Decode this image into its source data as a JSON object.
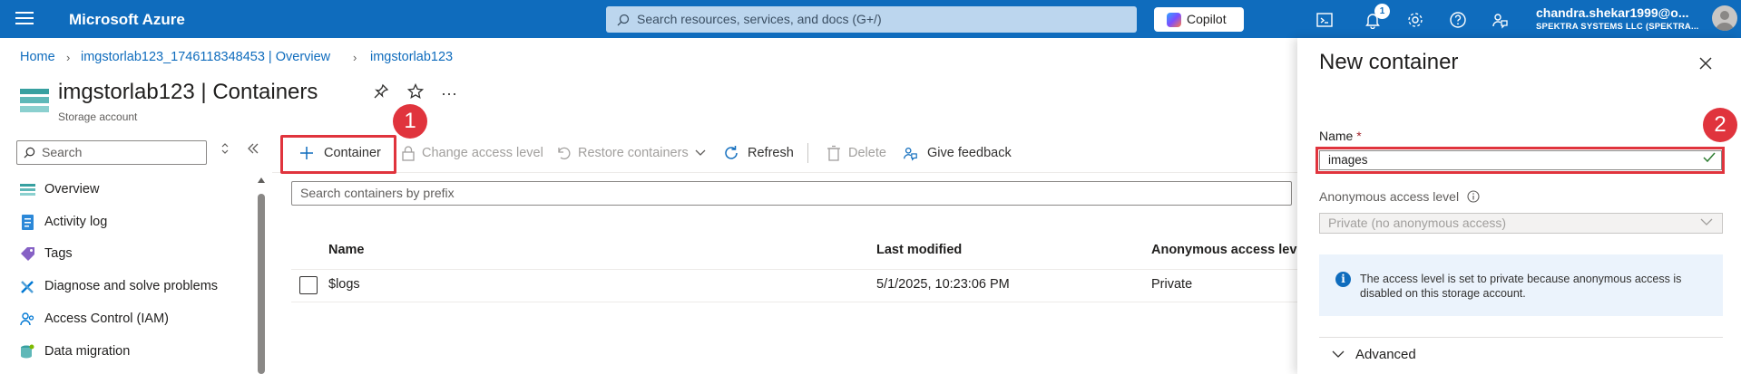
{
  "topbar": {
    "brand": "Microsoft Azure",
    "search_placeholder": "Search resources, services, and docs (G+/)",
    "copilot_label": "Copilot",
    "notification_count": "1",
    "account_user": "chandra.shekar1999@o...",
    "account_org": "SPEKTRA SYSTEMS LLC (SPEKTRA...",
    "icons": [
      "cloud-shell-icon",
      "notifications-icon",
      "settings-icon",
      "help-icon",
      "feedback-icon"
    ]
  },
  "breadcrumb": {
    "items": [
      "Home",
      "imgstorlab123_1746118348453 | Overview",
      "imgstorlab123"
    ]
  },
  "resource": {
    "title": "imgstorlab123 | Containers",
    "subtitle": "Storage account",
    "more": "···"
  },
  "sidebar": {
    "search_placeholder": "Search",
    "items": [
      {
        "label": "Overview",
        "icon": "overview-icon"
      },
      {
        "label": "Activity log",
        "icon": "activity-log-icon"
      },
      {
        "label": "Tags",
        "icon": "tag-icon"
      },
      {
        "label": "Diagnose and solve problems",
        "icon": "diagnose-icon"
      },
      {
        "label": "Access Control (IAM)",
        "icon": "iam-icon"
      },
      {
        "label": "Data migration",
        "icon": "data-migration-icon"
      }
    ]
  },
  "toolbar": {
    "container": "Container",
    "change_access": "Change access level",
    "restore": "Restore containers",
    "refresh": "Refresh",
    "delete": "Delete",
    "feedback": "Give feedback"
  },
  "markers": {
    "one": "1",
    "two": "2"
  },
  "list": {
    "filter_placeholder": "Search containers by prefix",
    "columns": [
      "Name",
      "Last modified",
      "Anonymous access level"
    ],
    "rows": [
      {
        "name": "$logs",
        "modified": "5/1/2025, 10:23:06 PM",
        "access": "Private"
      }
    ]
  },
  "panel": {
    "title": "New container",
    "name_label": "Name",
    "required_mark": "*",
    "name_value": "images",
    "access_label": "Anonymous access level",
    "access_value": "Private (no anonymous access)",
    "info_text": "The access level is set to private because anonymous access is disabled on this storage account.",
    "advanced_label": "Advanced"
  },
  "colors": {
    "azure_blue": "#0f6cbd",
    "annotation_red": "#e0343d",
    "info_bg": "#ebf3fc"
  }
}
